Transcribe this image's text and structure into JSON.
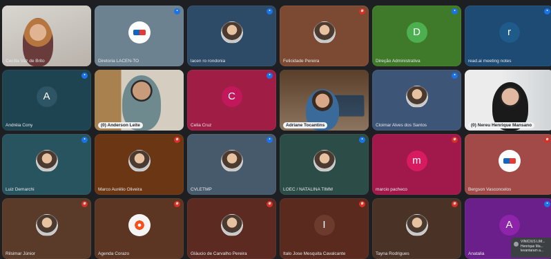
{
  "participants": [
    {
      "name": "Cecília Vaz de Brito",
      "mic": "",
      "tile_bg": "#c7c3bd",
      "avatar": "video-woman"
    },
    {
      "name": "Diretoria LACEN-TO",
      "mic": "blue",
      "tile_bg": "#6c8290",
      "avatar": "logo"
    },
    {
      "name": "lacen ro rondonia",
      "mic": "blue",
      "tile_bg": "#2d4a66",
      "avatar": "photo"
    },
    {
      "name": "Felicidade Pereira",
      "mic": "red",
      "tile_bg": "#7c4a33",
      "avatar": "photo"
    },
    {
      "name": "Direção Administrativa",
      "mic": "blue",
      "tile_bg": "#3e7a29",
      "avatar_letter": "D",
      "avatar_color": "#4caf50"
    },
    {
      "name": "read.ai meeting notes",
      "mic": "blue",
      "tile_bg": "#1e4b73",
      "avatar_letter": "r",
      "avatar_color": "#1e5a8a"
    },
    {
      "name": "Andréia Cony",
      "mic": "blue",
      "tile_bg": "#1d4450",
      "avatar_letter": "A",
      "avatar_color": "#2d5563"
    },
    {
      "name": "(0) Anderson Leite",
      "mic": "",
      "tile_bg": "#b9b2a6",
      "avatar": "video-man",
      "pill": true
    },
    {
      "name": "Celia Cruz",
      "mic": "blue",
      "tile_bg": "#a01d45",
      "avatar_letter": "C",
      "avatar_color": "#c2185b"
    },
    {
      "name": "Adriane Tocantins",
      "mic": "",
      "tile_bg": "#8a7a6a",
      "avatar": "video-woman2",
      "pill": true
    },
    {
      "name": "Cloimar Alves dos Santos",
      "mic": "blue",
      "tile_bg": "#3d5577",
      "avatar": "photo"
    },
    {
      "name": "(0) Nereu Henrique Mansano",
      "mic": "",
      "tile_bg": "#d8d8d8",
      "avatar": "video-man2",
      "pill": true
    },
    {
      "name": "Luiz Demarchi",
      "mic": "blue",
      "tile_bg": "#27545e",
      "avatar": "photo"
    },
    {
      "name": "Marco Aurélio Oliveira",
      "mic": "red",
      "tile_bg": "#6b3613",
      "avatar": "photo"
    },
    {
      "name": "CVLETMP",
      "mic": "blue",
      "tile_bg": "#475a6c",
      "avatar": "photo"
    },
    {
      "name": "LOEC / NATALINA TIMM",
      "mic": "blue",
      "tile_bg": "#2c4c47",
      "avatar": "photo"
    },
    {
      "name": "marcio pacheco",
      "mic": "red",
      "tile_bg": "#a0194a",
      "avatar_letter": "m",
      "avatar_color": "#d81b60"
    },
    {
      "name": "Bergson Vasconcelos",
      "mic": "red",
      "tile_bg": "#a14a47",
      "avatar": "logo"
    },
    {
      "name": "Rilsimar Júnior",
      "mic": "red",
      "tile_bg": "#5a3a29",
      "avatar": "photo"
    },
    {
      "name": "Agenda Corazo",
      "mic": "red",
      "tile_bg": "#5c3523",
      "avatar": "flower"
    },
    {
      "name": "Gláucio de Carvalho Pereira",
      "mic": "red",
      "tile_bg": "#5d2a22",
      "avatar": "photo"
    },
    {
      "name": "Italo Jose Mesquita Cavalcante",
      "mic": "red",
      "tile_bg": "#5a2a1f",
      "avatar_letter": "I",
      "avatar_color": "#6d3b2d"
    },
    {
      "name": "Tayna Rodrigues",
      "mic": "red",
      "tile_bg": "#4a3326",
      "avatar": "photo"
    },
    {
      "name": "Anatalia",
      "mic": "blue",
      "tile_bg": "#6a1f8a",
      "avatar_letter": "A",
      "avatar_color": "#8e24aa"
    }
  ],
  "toast": {
    "line1": "VINICIUS LIM...",
    "line2": "Henrique Ma...",
    "line3": "levantaram a..."
  },
  "colors": {
    "background": "#1d1f22",
    "mic_blue": "#1a73e8",
    "mic_red": "#d93025"
  }
}
